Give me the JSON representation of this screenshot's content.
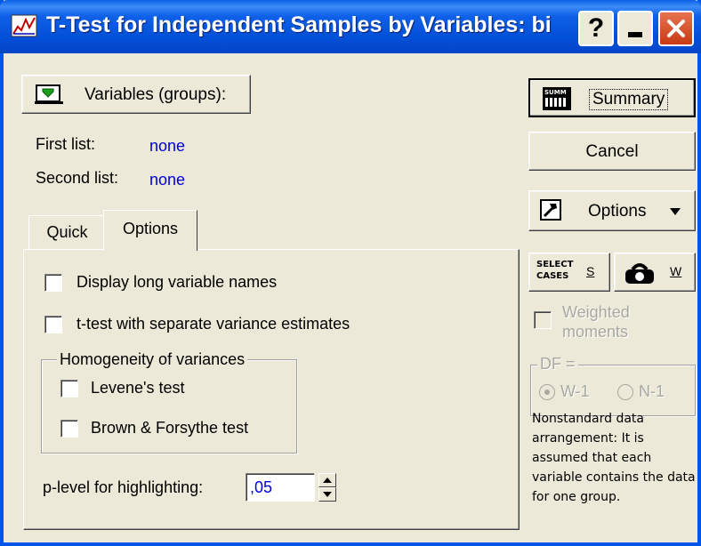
{
  "window": {
    "title": "T-Test for Independent Samples by Variables: bi",
    "help_label": "?"
  },
  "variables": {
    "button_label": "Variables (groups):",
    "first_list_label": "First list:",
    "first_list_value": "none",
    "second_list_label": "Second list:",
    "second_list_value": "none"
  },
  "tabs": [
    {
      "label": "Quick",
      "active": false
    },
    {
      "label": "Options",
      "active": true
    }
  ],
  "options": {
    "display_long_names": {
      "label": "Display long variable names",
      "checked": false
    },
    "separate_variance": {
      "label": "t-test with separate variance estimates",
      "checked": false
    },
    "homogeneity": {
      "title": "Homogeneity of variances",
      "levene": {
        "label": "Levene's test",
        "checked": false
      },
      "brown_forsythe": {
        "label": "Brown & Forsythe test",
        "checked": false
      }
    },
    "p_level": {
      "label": "p-level for highlighting:",
      "value": ",05"
    }
  },
  "side": {
    "summary_label": "Summary",
    "summary_icon_text": "SUMM",
    "cancel_label": "Cancel",
    "options_label": "Options",
    "select_cases_icon_text": "SELECT\nCASES",
    "select_cases_label": "S",
    "weight_label": "W",
    "weighted_moments": {
      "label": "Weighted moments",
      "checked": false
    },
    "df": {
      "title": "DF =",
      "options": [
        "W-1",
        "N-1"
      ],
      "selected": "W-1"
    },
    "note": "Nonstandard data arrangement: It is assumed that each variable contains the data for one group."
  }
}
